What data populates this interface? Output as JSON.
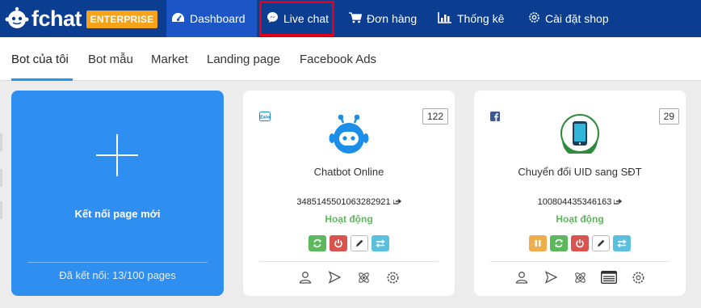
{
  "header": {
    "logo_text": "fchat",
    "plan_badge": "ENTERPRISE",
    "nav": [
      {
        "label": "Dashboard",
        "icon": "dashboard-icon"
      },
      {
        "label": "Live chat",
        "icon": "messenger-icon",
        "highlighted": true
      },
      {
        "label": "Đơn hàng",
        "icon": "cart-icon"
      },
      {
        "label": "Thống kê",
        "icon": "bar-chart-icon"
      },
      {
        "label": "Cài đặt shop",
        "icon": "gear-icon"
      }
    ]
  },
  "tabs": [
    {
      "label": "Bot của tôi",
      "active": true
    },
    {
      "label": "Bot mẫu"
    },
    {
      "label": "Market"
    },
    {
      "label": "Landing page"
    },
    {
      "label": "Facebook Ads"
    }
  ],
  "new_page_card": {
    "label": "Kết nối page mới",
    "connected": "Đã kết nối: 13/100 pages"
  },
  "bots": [
    {
      "platform": "Zalo",
      "platform_icon": "zalo-icon",
      "count": "122",
      "name": "Chatbot Online",
      "id": "3485145501063282921",
      "status": "Hoạt động",
      "actions": [
        "refresh",
        "power",
        "edit",
        "transfer"
      ],
      "footer_icons": [
        "user-icon",
        "send-icon",
        "atom-icon",
        "gear-icon"
      ]
    },
    {
      "platform": "Facebook",
      "platform_icon": "facebook-icon",
      "count": "29",
      "name": "Chuyển đổi UID sang SĐT",
      "id": "100804435346163",
      "status": "Hoạt động",
      "actions": [
        "pause",
        "refresh",
        "power",
        "edit",
        "transfer"
      ],
      "footer_icons": [
        "user-icon",
        "send-icon",
        "atom-icon",
        "list-icon",
        "gear-icon"
      ]
    }
  ],
  "colors": {
    "nav_bg": "#0b3d91",
    "nav_active": "#1c56c6",
    "highlight_border": "#e3001b",
    "badge": "#f7a21b",
    "accent": "#2f8ff0",
    "status_green": "#5cb85c"
  }
}
